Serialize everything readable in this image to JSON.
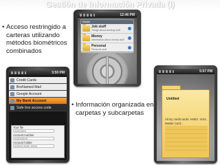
{
  "slide": {
    "title": "Gestión de Información Privada (I)"
  },
  "bullets": [
    {
      "marker": "•",
      "text": "Acceso restringido a carteras utilizando métodos biométricos combinados"
    },
    {
      "marker": "•",
      "text": "Información organizada en carpetas y subcarpetas"
    }
  ],
  "phones": {
    "top": {
      "time": "12:46 PM",
      "list_header": "Wallet",
      "items": [
        {
          "name": "Job stuff",
          "subtitle": "Things about working stuff"
        },
        {
          "name": "Money",
          "subtitle": "Information about money stuff"
        },
        {
          "name": "Personal",
          "subtitle": "Personal stuff"
        }
      ]
    },
    "left": {
      "time": "3:50 PM",
      "menu": [
        {
          "label": "Credit Cards",
          "style": "light"
        },
        {
          "label": "BroNamed Mail",
          "style": "light"
        },
        {
          "label": "Google Account",
          "style": "light"
        },
        {
          "label": "My Bank Account",
          "style": "selected"
        },
        {
          "label": "Safe box access code",
          "style": "dark"
        }
      ],
      "form": [
        {
          "label": "Your file",
          "value": "XXXXXXX"
        },
        {
          "label": "Account number",
          "value": "XXXXXXXX"
        },
        {
          "label": "Account holder",
          "value": "XXXXX XXXX XXXX"
        }
      ]
    },
    "right": {
      "time": "5:57 PM",
      "folder_title": "Untitled",
      "note": "All my credit cards: AMEX, VISA, Master Card..."
    }
  },
  "colors": {
    "title_text": "#ffffff",
    "selection": "#f28c28",
    "folder": "#efc659"
  }
}
